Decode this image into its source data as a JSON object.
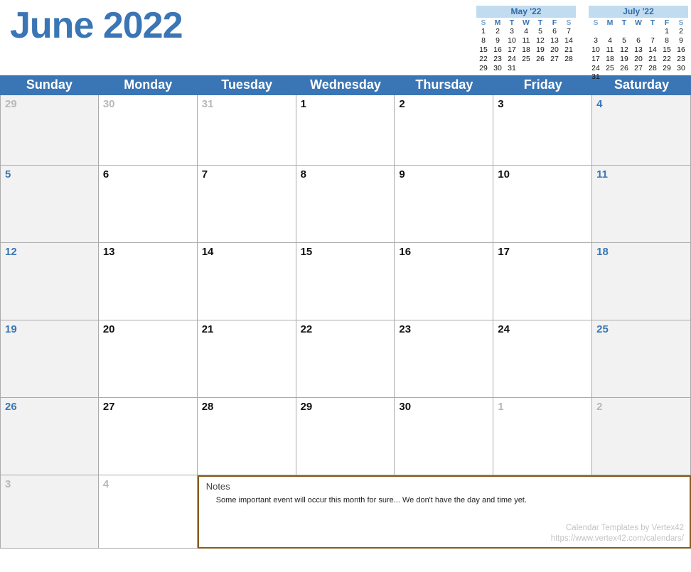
{
  "title": "June 2022",
  "mini_prev": {
    "title": "May '22",
    "dow": [
      "S",
      "M",
      "T",
      "W",
      "T",
      "F",
      "S"
    ],
    "rows": [
      [
        "1",
        "2",
        "3",
        "4",
        "5",
        "6",
        "7"
      ],
      [
        "8",
        "9",
        "10",
        "11",
        "12",
        "13",
        "14"
      ],
      [
        "15",
        "16",
        "17",
        "18",
        "19",
        "20",
        "21"
      ],
      [
        "22",
        "23",
        "24",
        "25",
        "26",
        "27",
        "28"
      ],
      [
        "29",
        "30",
        "31",
        "",
        "",
        "",
        ""
      ]
    ]
  },
  "mini_next": {
    "title": "July '22",
    "dow": [
      "S",
      "M",
      "T",
      "W",
      "T",
      "F",
      "S"
    ],
    "rows": [
      [
        "",
        "",
        "",
        "",
        "",
        "1",
        "2"
      ],
      [
        "3",
        "4",
        "5",
        "6",
        "7",
        "8",
        "9"
      ],
      [
        "10",
        "11",
        "12",
        "13",
        "14",
        "15",
        "16"
      ],
      [
        "17",
        "18",
        "19",
        "20",
        "21",
        "22",
        "23"
      ],
      [
        "24",
        "25",
        "26",
        "27",
        "28",
        "29",
        "30"
      ],
      [
        "31",
        "",
        "",
        "",
        "",
        "",
        ""
      ]
    ]
  },
  "dow": [
    "Sunday",
    "Monday",
    "Tuesday",
    "Wednesday",
    "Thursday",
    "Friday",
    "Saturday"
  ],
  "cells": [
    {
      "n": "29",
      "cls": "muted wkend-bg"
    },
    {
      "n": "30",
      "cls": "muted"
    },
    {
      "n": "31",
      "cls": "muted"
    },
    {
      "n": "1",
      "cls": ""
    },
    {
      "n": "2",
      "cls": ""
    },
    {
      "n": "3",
      "cls": ""
    },
    {
      "n": "4",
      "cls": "wkend wkend-bg"
    },
    {
      "n": "5",
      "cls": "wkend wkend-bg"
    },
    {
      "n": "6",
      "cls": ""
    },
    {
      "n": "7",
      "cls": ""
    },
    {
      "n": "8",
      "cls": ""
    },
    {
      "n": "9",
      "cls": ""
    },
    {
      "n": "10",
      "cls": ""
    },
    {
      "n": "11",
      "cls": "wkend wkend-bg"
    },
    {
      "n": "12",
      "cls": "wkend wkend-bg"
    },
    {
      "n": "13",
      "cls": ""
    },
    {
      "n": "14",
      "cls": ""
    },
    {
      "n": "15",
      "cls": ""
    },
    {
      "n": "16",
      "cls": ""
    },
    {
      "n": "17",
      "cls": ""
    },
    {
      "n": "18",
      "cls": "wkend wkend-bg"
    },
    {
      "n": "19",
      "cls": "wkend wkend-bg"
    },
    {
      "n": "20",
      "cls": ""
    },
    {
      "n": "21",
      "cls": ""
    },
    {
      "n": "22",
      "cls": ""
    },
    {
      "n": "23",
      "cls": ""
    },
    {
      "n": "24",
      "cls": ""
    },
    {
      "n": "25",
      "cls": "wkend wkend-bg"
    },
    {
      "n": "26",
      "cls": "wkend wkend-bg"
    },
    {
      "n": "27",
      "cls": ""
    },
    {
      "n": "28",
      "cls": ""
    },
    {
      "n": "29",
      "cls": ""
    },
    {
      "n": "30",
      "cls": ""
    },
    {
      "n": "1",
      "cls": "muted"
    },
    {
      "n": "2",
      "cls": "muted wkend-bg"
    },
    {
      "n": "3",
      "cls": "muted wkend-bg"
    },
    {
      "n": "4",
      "cls": "muted"
    }
  ],
  "notes": {
    "label": "Notes",
    "text": "Some important event will occur this month for sure... We don't have the day and time yet."
  },
  "credits": {
    "line1": "Calendar Templates by Vertex42",
    "line2": "https://www.vertex42.com/calendars/"
  }
}
